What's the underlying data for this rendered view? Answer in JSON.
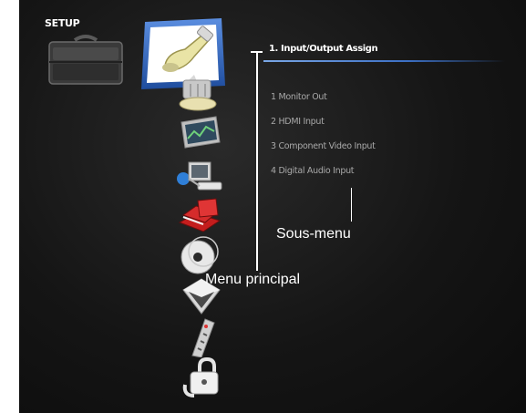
{
  "setup": {
    "label": "SETUP"
  },
  "main_menu": {
    "items": [
      {
        "icon": "hdmi-cable-icon",
        "selected": true
      },
      {
        "icon": "satellite-receiver-icon"
      },
      {
        "icon": "tv-screen-icon"
      },
      {
        "icon": "network-devices-icon"
      },
      {
        "icon": "book-stack-icon"
      },
      {
        "icon": "disc-icon"
      },
      {
        "icon": "cube-icon"
      },
      {
        "icon": "remote-control-icon"
      },
      {
        "icon": "padlock-icon"
      }
    ]
  },
  "submenu": {
    "title": "1. Input/Output Assign",
    "items": [
      "1 Monitor Out",
      "2 HDMI Input",
      "3 Component Video Input",
      "4 Digital Audio Input"
    ]
  },
  "callouts": {
    "submenu": "Sous-menu",
    "main_menu": "Menu principal"
  },
  "colors": {
    "selection_border": "#3b6fc4",
    "title_rule": "#7aa7e6",
    "submenu_text": "#a9a9a9"
  }
}
